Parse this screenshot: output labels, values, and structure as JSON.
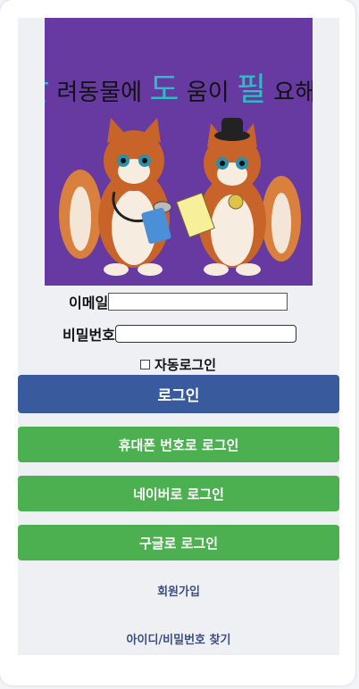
{
  "hero": {
    "title_segments": [
      {
        "text": "반",
        "color": "#2bbfc4"
      },
      {
        "text": "려동물에 ",
        "color": "#111111"
      },
      {
        "text": "도",
        "color": "#2bbfc4"
      },
      {
        "text": "움이 ",
        "color": "#111111"
      },
      {
        "text": "필",
        "color": "#2bbfc4"
      },
      {
        "text": "요해요",
        "color": "#111111"
      }
    ],
    "background": "#663aa0",
    "illustration": "two-cats-vet-and-butler"
  },
  "form": {
    "email_label": "이메일",
    "email_value": "",
    "password_label": "비밀번호",
    "password_value": "",
    "auto_login_label": "자동로그인",
    "auto_login_checked": false
  },
  "buttons": {
    "login": "로그인",
    "phone_login": "휴대폰 번호로 로그인",
    "naver_login": "네이버로 로그인",
    "google_login": "구글로 로그인"
  },
  "links": {
    "signup": "회원가입",
    "find_account": "아이디/비밀번호 찾기"
  },
  "colors": {
    "primary": "#3a5a9e",
    "green": "#4caf50",
    "link": "#3a4f86"
  }
}
